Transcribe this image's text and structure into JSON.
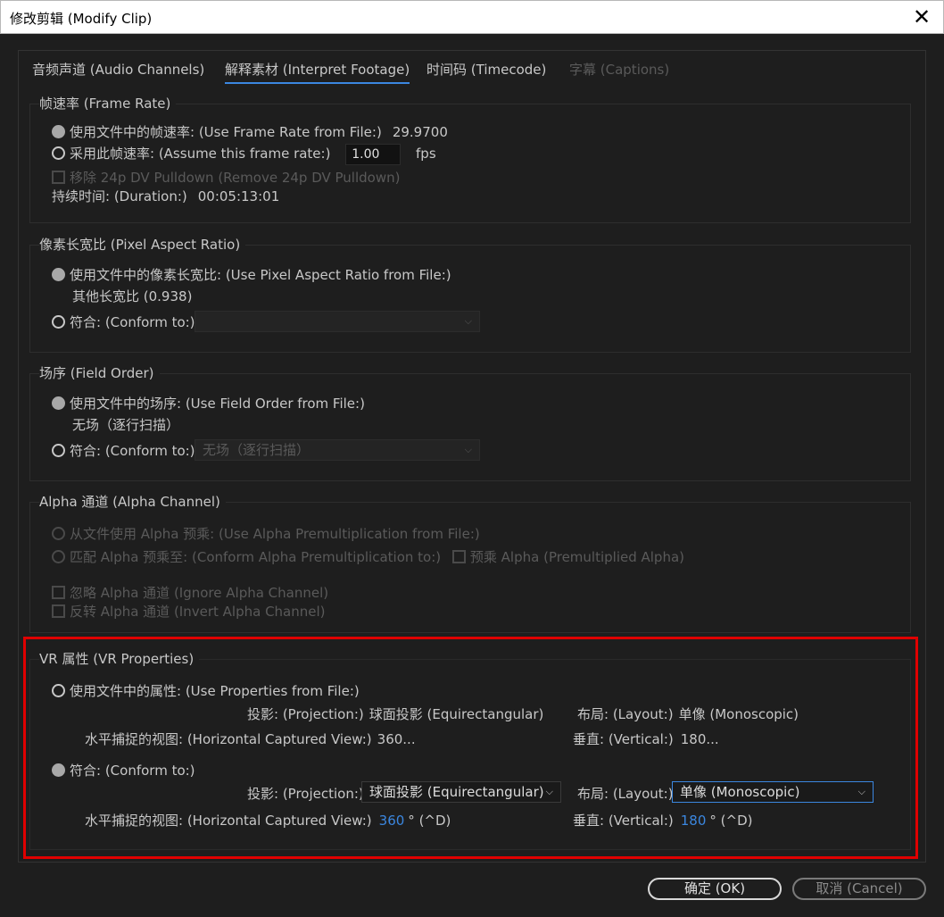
{
  "window": {
    "title": "修改剪辑 (Modify Clip)",
    "close_glyph": "✕"
  },
  "tabs": [
    {
      "label": "音频声道 (Audio Channels)"
    },
    {
      "label": "解释素材 (Interpret Footage)"
    },
    {
      "label": "时间码 (Timecode)"
    },
    {
      "label": "字幕 (Captions)"
    }
  ],
  "frame_rate": {
    "title": "帧速率 (Frame Rate)",
    "use_file_label": "使用文件中的帧速率: (Use Frame Rate from File:)",
    "use_file_value": "29.9700",
    "assume_label": "采用此帧速率: (Assume this frame rate:)",
    "assume_value": "1.00",
    "fps": "fps",
    "pulldown_label": "移除 24p DV Pulldown (Remove 24p DV Pulldown)",
    "duration_label": "持续时间: (Duration:)",
    "duration_value": "00:05:13:01"
  },
  "pixel_aspect": {
    "title": "像素长宽比 (Pixel Aspect Ratio)",
    "use_file_label": "使用文件中的像素长宽比: (Use Pixel Aspect Ratio from File:)",
    "file_value": "其他长宽比 (0.938)",
    "conform_label": "符合: (Conform to:)",
    "conform_value": ""
  },
  "field_order": {
    "title": "场序 (Field Order)",
    "use_file_label": "使用文件中的场序: (Use Field Order from File:)",
    "file_value": "无场（逐行扫描）",
    "conform_label": "符合: (Conform to:)",
    "conform_value": "无场（逐行扫描）"
  },
  "alpha": {
    "title": "Alpha 通道 (Alpha Channel)",
    "use_file_label": "从文件使用 Alpha 预乘: (Use Alpha Premultiplication from File:)",
    "conform_label": "匹配 Alpha 预乘至: (Conform Alpha Premultiplication to:)",
    "premult_label": "预乘 Alpha (Premultiplied Alpha)",
    "ignore_label": "忽略 Alpha 通道 (Ignore Alpha Channel)",
    "invert_label": "反转 Alpha 通道 (Invert Alpha Channel)"
  },
  "vr": {
    "title": "VR 属性 (VR Properties)",
    "use_file_label": "使用文件中的属性: (Use Properties from File:)",
    "projection_label": "投影: (Projection:)",
    "projection_file_value": "球面投影 (Equirectangular)",
    "layout_label": "布局: (Layout:)",
    "layout_file_value": "单像 (Monoscopic)",
    "hview_label": "水平捕捉的视图: (Horizontal Captured View:)",
    "hview_file_value": "360...",
    "vertical_label": "垂直: (Vertical:)",
    "vertical_file_value": "180...",
    "conform_label": "符合: (Conform to:)",
    "projection_select": "球面投影 (Equirectangular)",
    "layout_select": "单像 (Monoscopic)",
    "hview_num": "360",
    "hview_unit": "° (^D)",
    "vertical_num": "180",
    "vertical_unit": "° (^D)"
  },
  "buttons": {
    "ok": "确定 (OK)",
    "cancel": "取消 (Cancel)"
  },
  "colors": {
    "accent": "#3b87e0",
    "highlight_box": "#e00000"
  }
}
